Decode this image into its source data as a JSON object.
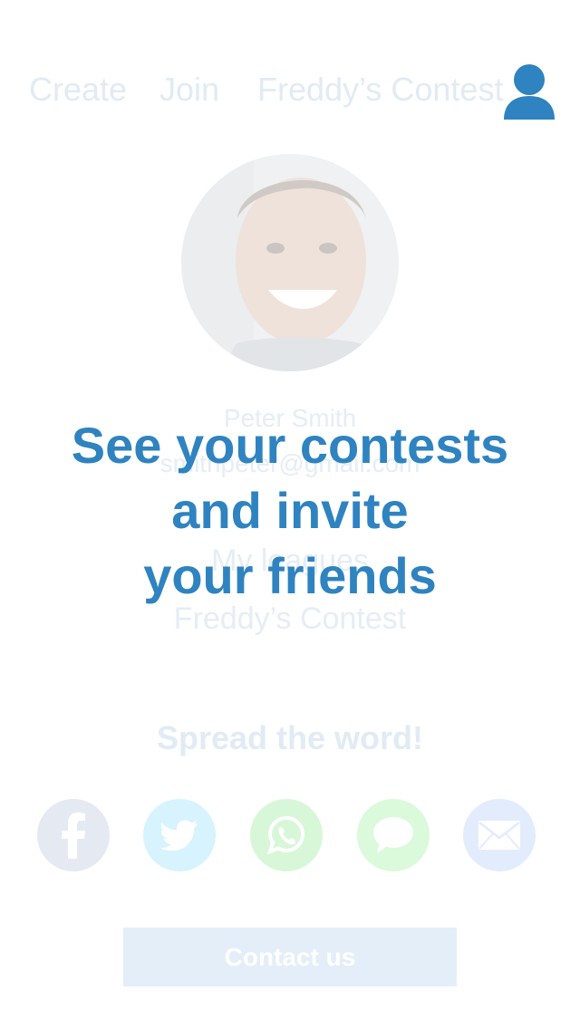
{
  "nav": {
    "create_label": "Create",
    "join_label": "Join",
    "contest_label": "Freddy’s Contest",
    "profile_icon": "user-icon",
    "accent_color": "#2e83c0"
  },
  "profile": {
    "avatar_icon": "profile-photo",
    "name": "Peter Smith",
    "email": "smithpeter@gmail.com",
    "leagues_heading": "My leagues",
    "leagues": [
      "Freddy’s Contest"
    ]
  },
  "overlay": {
    "lines": [
      "See your contests",
      "and invite",
      "your friends"
    ]
  },
  "share": {
    "heading": "Spread the word!",
    "buttons": [
      {
        "icon": "facebook-icon",
        "color": "#e5e9f2"
      },
      {
        "icon": "twitter-icon",
        "color": "#d7f3fd"
      },
      {
        "icon": "whatsapp-icon",
        "color": "#d8f7d9"
      },
      {
        "icon": "message-icon",
        "color": "#dbf9db"
      },
      {
        "icon": "email-icon",
        "color": "#e2ecfd"
      }
    ]
  },
  "contact": {
    "label": "Contact us"
  }
}
